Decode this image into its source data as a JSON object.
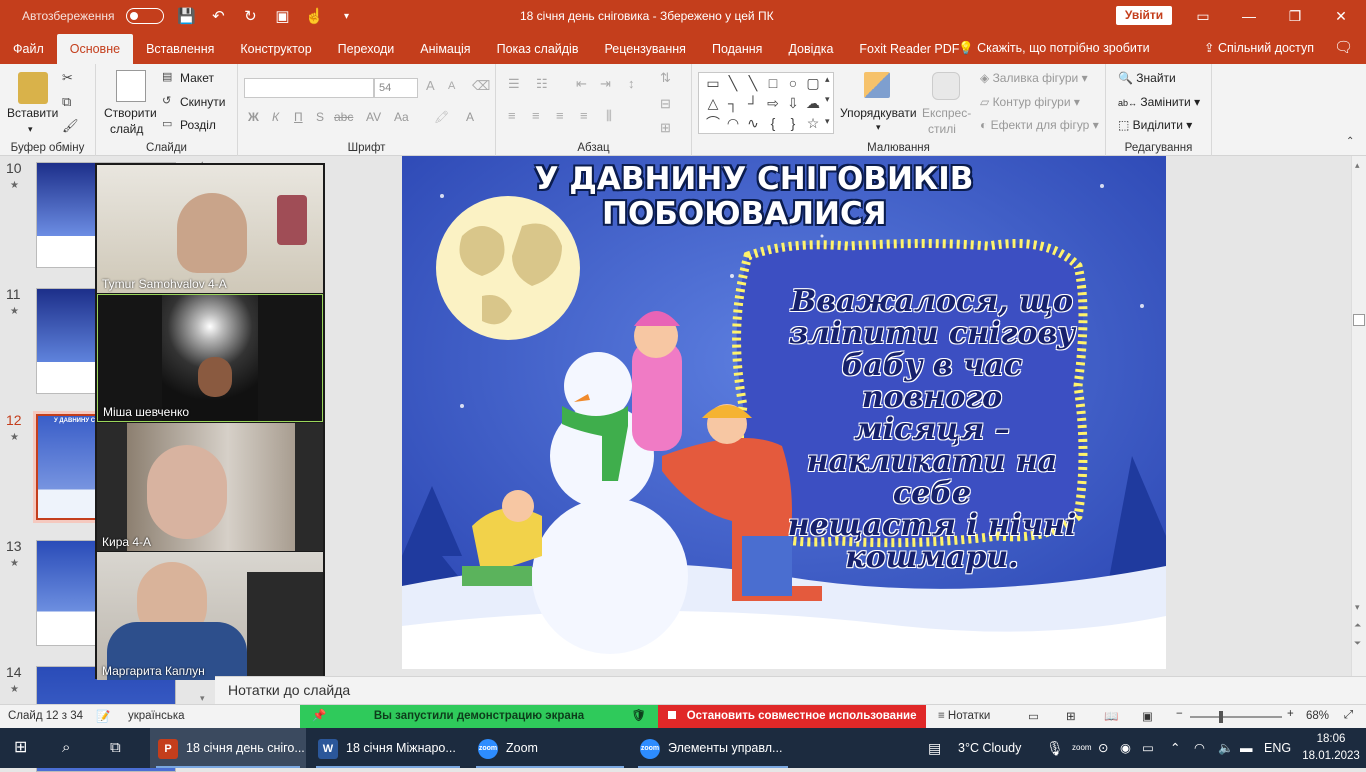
{
  "titlebar": {
    "autosave_label": "Автозбереження",
    "autosave_state": "off",
    "doc_title": "18 січня день сніговика  -  Збережено у цей ПК",
    "signin_label": "Увійти",
    "accent": "#c43e1c"
  },
  "tabs": [
    "Файл",
    "Основне",
    "Вставлення",
    "Конструктор",
    "Переходи",
    "Анімація",
    "Показ слайдів",
    "Рецензування",
    "Подання",
    "Довідка",
    "Foxit Reader PDF"
  ],
  "active_tab": "Основне",
  "tell_me": "Скажіть, що потрібно зробити",
  "share_label": "Спільний доступ",
  "ribbon": {
    "clipboard": {
      "paste": "Вставити",
      "group": "Буфер обміну"
    },
    "slides": {
      "new_slide_line1": "Створити",
      "new_slide_line2": "слайд",
      "layout": "Макет",
      "reset": "Скинути",
      "section": "Розділ",
      "group": "Слайди"
    },
    "font": {
      "font_size": "54",
      "bold": "Ж",
      "italic": "К",
      "underline": "П",
      "strike": "S",
      "spacing": "abc",
      "case": "Aa",
      "group": "Шрифт"
    },
    "paragraph": {
      "group": "Абзац"
    },
    "drawing": {
      "arrange": "Упорядкувати",
      "styles_line1": "Експрес-",
      "styles_line2": "стилі",
      "fill": "Заливка фігури",
      "outline": "Контур фігури",
      "effects": "Ефекти для фігур",
      "group": "Малювання"
    },
    "editing": {
      "find": "Знайти",
      "replace": "Замінити",
      "select": "Виділити",
      "group": "Редагування"
    }
  },
  "thumbnails": [
    {
      "number": "10"
    },
    {
      "number": "11"
    },
    {
      "number": "12"
    },
    {
      "number": "13"
    },
    {
      "number": "14"
    }
  ],
  "selected_slide": "12",
  "thumb12_title": "У ДАВНИНУ СНІГОВ ПОБОЮ",
  "zoom_participants": [
    {
      "name": "Tymur Samohvalov 4-A"
    },
    {
      "name": "Міша шевченко"
    },
    {
      "name": "Кира 4-А"
    },
    {
      "name": "Маргарита Каплун"
    }
  ],
  "slide": {
    "title_line1": "У ДАВНИНУ СНІГОВИКІВ",
    "title_line2": "ПОБОЮВАЛИСЯ",
    "body_lines": [
      "Вважалося,  що",
      "зліпити снігову",
      "бабу в час повного",
      "місяця  –",
      "накликати на себе",
      "нещастя і нічні",
      "кошмари."
    ]
  },
  "notes_placeholder": "Нотатки до слайда",
  "status": {
    "slide_info": "Слайд 12 з 34",
    "language": "українська",
    "sharing_message": "Вы запустили демонстрацию экрана",
    "stop_sharing": "Остановить совместное использование",
    "notes_label": "Нотатки",
    "zoom_level": "68%",
    "zoom_fraction": 0.68
  },
  "taskbar": {
    "apps": [
      {
        "label": "18 січня день сніго...",
        "icon": "powerpoint-icon",
        "color": "#c43e1c"
      },
      {
        "label": "18 січня  Міжнаро...",
        "icon": "word-icon",
        "color": "#2b579a"
      },
      {
        "label": "Zoom",
        "icon": "zoom-icon",
        "color": "#2d8cff"
      },
      {
        "label": "Элементы управл...",
        "icon": "zoom-icon",
        "color": "#2d8cff"
      }
    ],
    "weather": "3°C  Cloudy",
    "keyboard_lang": "ENG",
    "time": "18:06",
    "date": "18.01.2023"
  }
}
